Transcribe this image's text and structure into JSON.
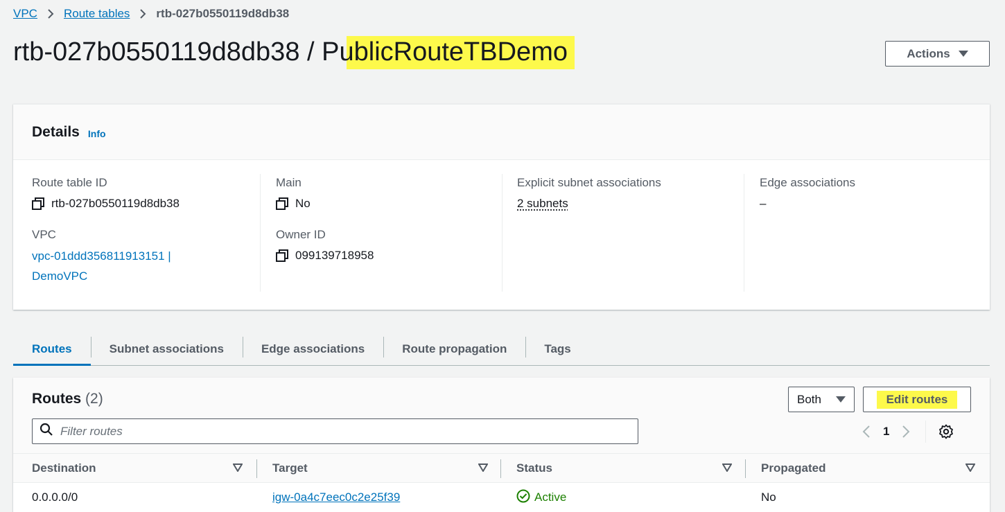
{
  "breadcrumb": {
    "items": [
      "VPC",
      "Route tables"
    ],
    "current": "rtb-027b0550119d8db38"
  },
  "page": {
    "title_id": "rtb-027b0550119d8db38",
    "title_sep": " / ",
    "title_name": "PublicRouteTBDemo",
    "actions_label": "Actions"
  },
  "details": {
    "title": "Details",
    "info": "Info",
    "route_table_id_label": "Route table ID",
    "route_table_id": "rtb-027b0550119d8db38",
    "main_label": "Main",
    "main": "No",
    "explicit_label": "Explicit subnet associations",
    "explicit": "2 subnets",
    "edge_label": "Edge associations",
    "edge": "–",
    "vpc_label": "VPC",
    "vpc_line1": "vpc-01ddd356811913151 |",
    "vpc_line2": "DemoVPC",
    "owner_label": "Owner ID",
    "owner": "099139718958"
  },
  "tabs": [
    "Routes",
    "Subnet associations",
    "Edge associations",
    "Route propagation",
    "Tags"
  ],
  "routes": {
    "title": "Routes",
    "count": "(2)",
    "filter_select": "Both",
    "edit_label": "Edit routes",
    "filter_placeholder": "Filter routes",
    "page": "1",
    "columns": [
      "Destination",
      "Target",
      "Status",
      "Propagated"
    ],
    "rows": [
      {
        "destination": "0.0.0.0/0",
        "target": "igw-0a4c7eec0c2e25f39",
        "status": "Active",
        "propagated": "No"
      }
    ]
  },
  "colors": {
    "link": "#0073bb",
    "highlight": "#fdf94b",
    "success": "#1d8102"
  }
}
